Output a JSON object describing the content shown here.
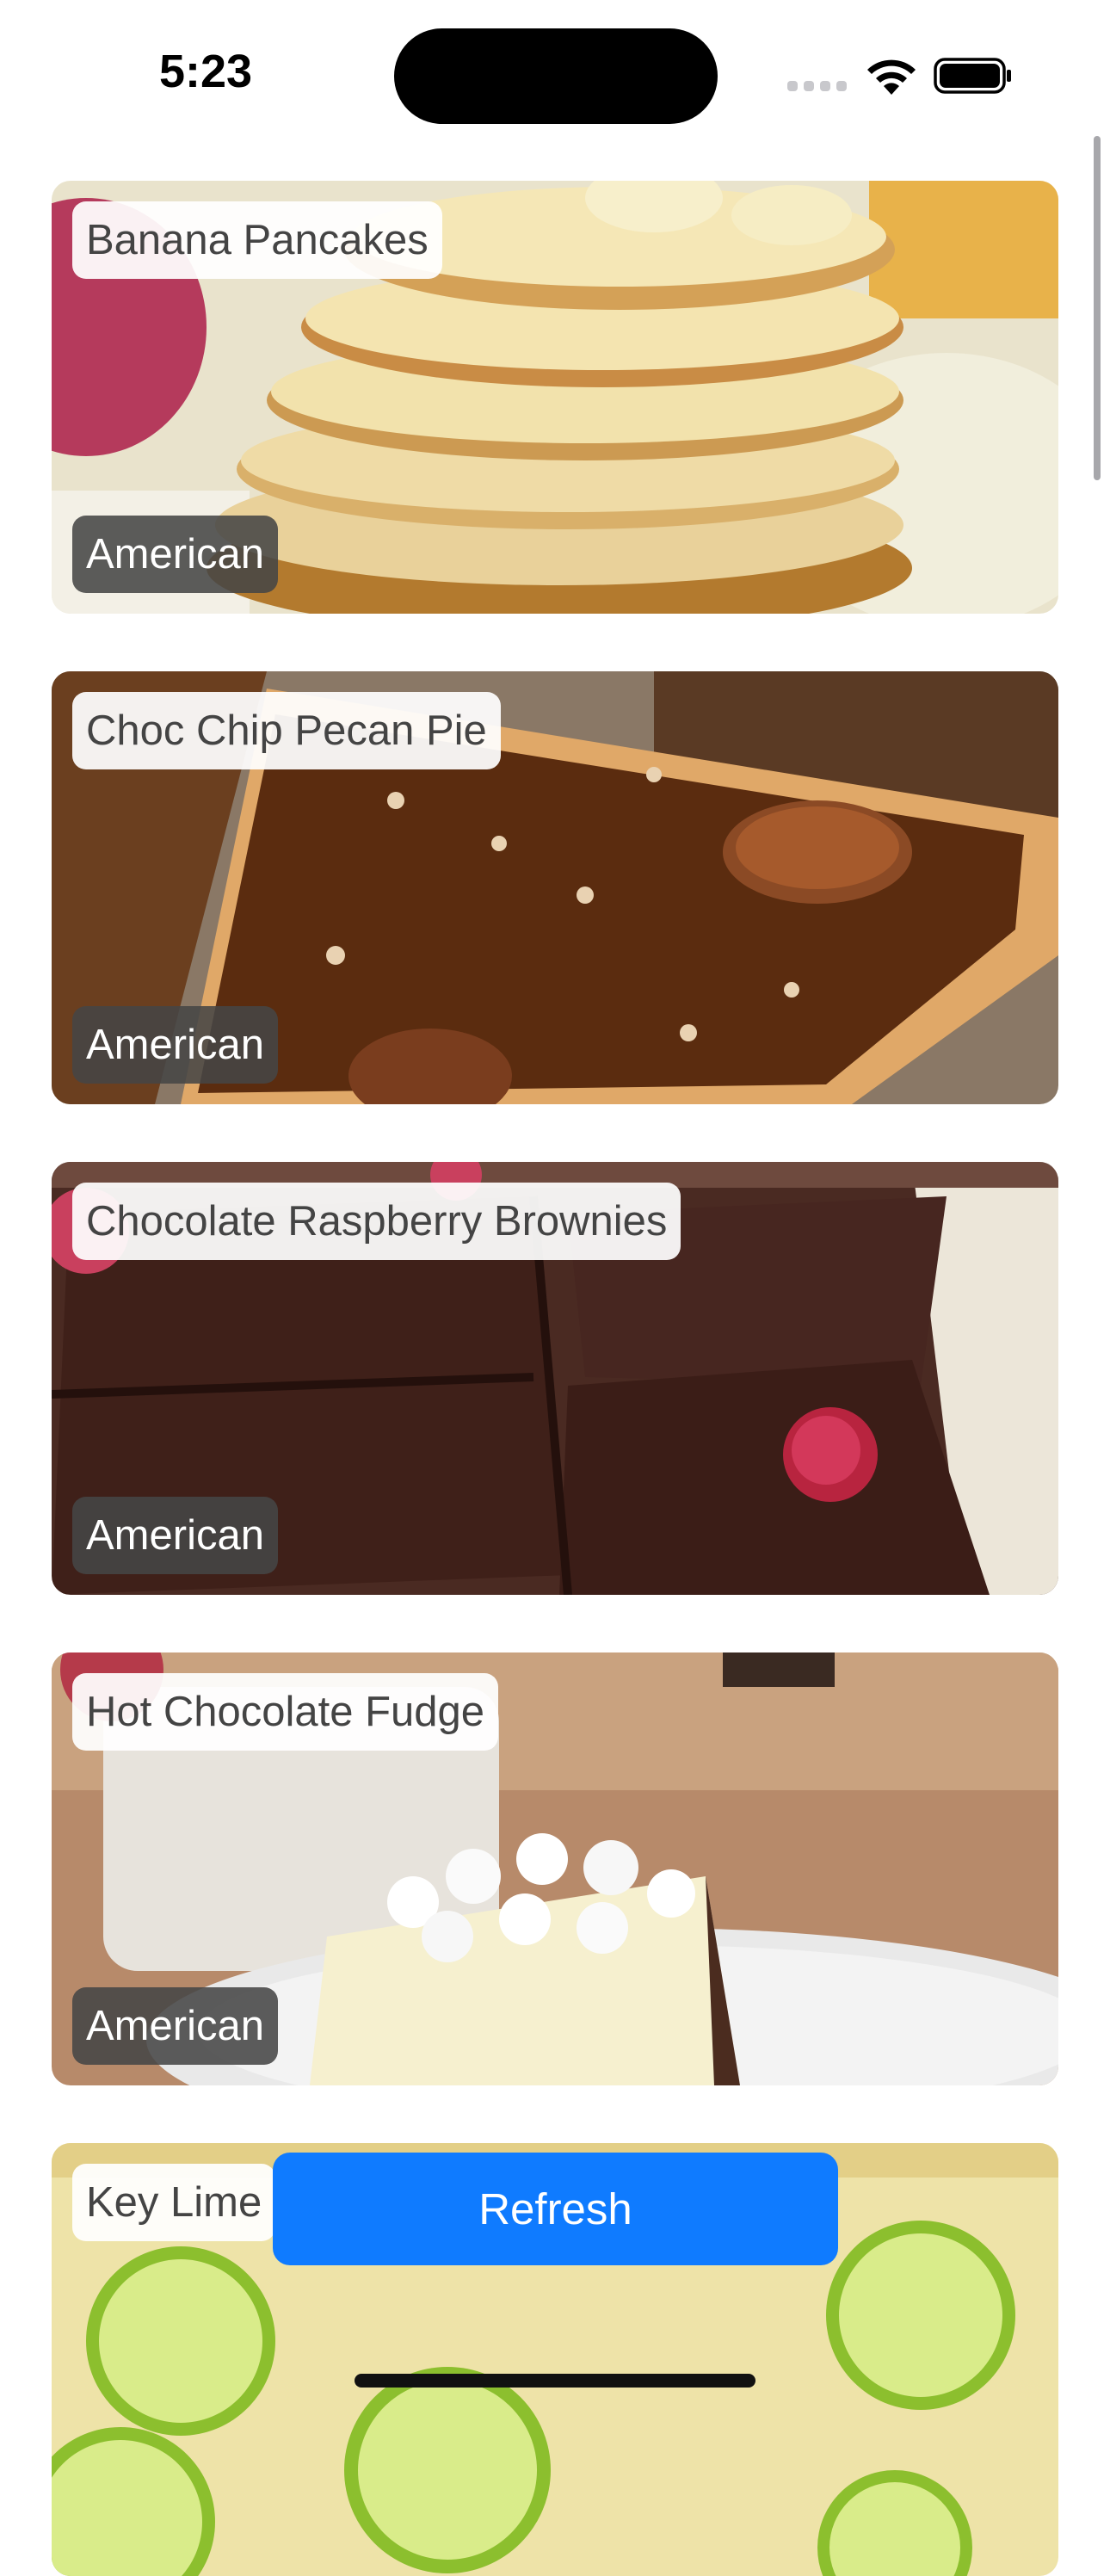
{
  "status_bar": {
    "time": "5:23"
  },
  "recipes": [
    {
      "name": "Banana Pancakes",
      "cuisine": "American"
    },
    {
      "name": "Choc Chip Pecan Pie",
      "cuisine": "American"
    },
    {
      "name": "Chocolate Raspberry Brownies",
      "cuisine": "American"
    },
    {
      "name": "Hot Chocolate Fudge",
      "cuisine": "American"
    },
    {
      "name": "Key Lime"
    }
  ],
  "refresh_button": {
    "label": "Refresh"
  },
  "colors": {
    "accent": "#0f7bff"
  }
}
